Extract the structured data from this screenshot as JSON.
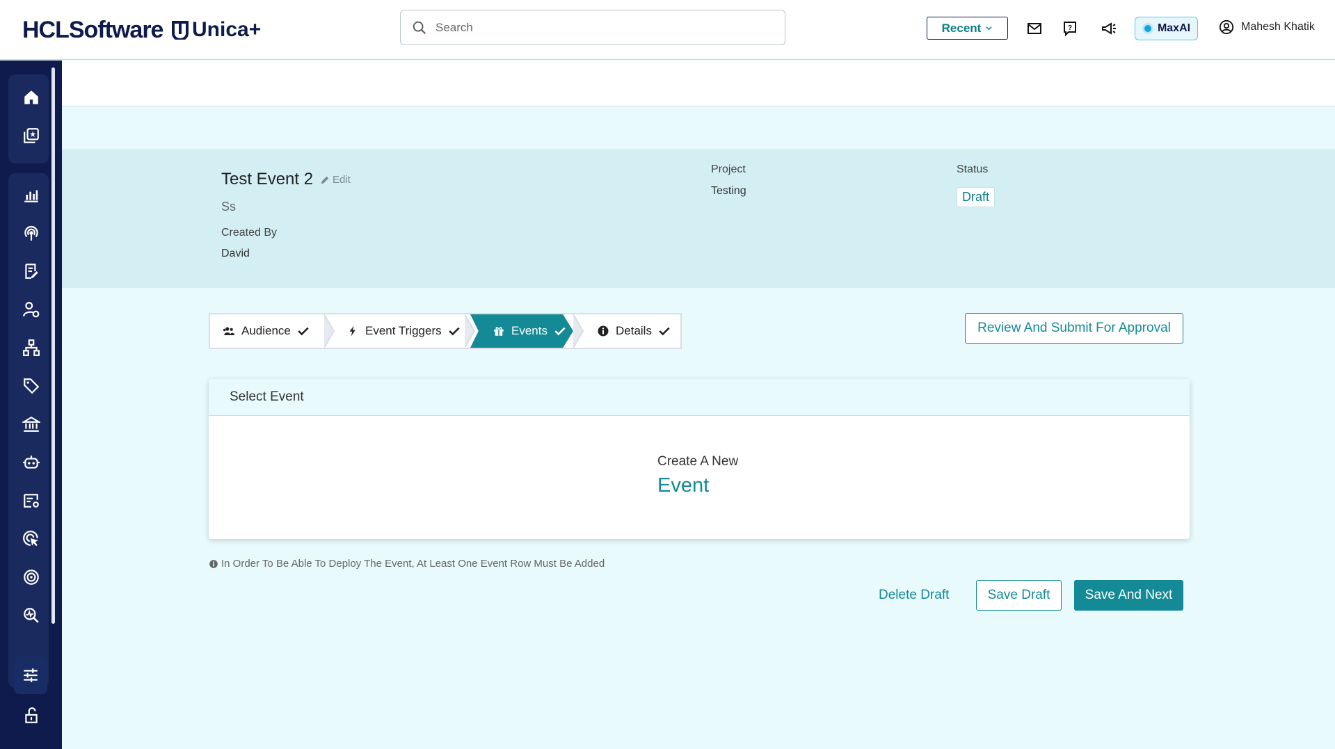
{
  "header": {
    "brand": "HCLSoftware",
    "product": "Unica+",
    "search_placeholder": "Search",
    "recent_label": "Recent",
    "maxai_label": "MaxAI",
    "user_name": "Mahesh Khatik",
    "icons": [
      "mail-icon",
      "help-icon",
      "announcement-icon"
    ]
  },
  "sidebar": {
    "items": [
      "home-icon",
      "gallery-icon",
      "analytics-icon",
      "broadcast-icon",
      "document-edit-icon",
      "user-settings-icon",
      "hierarchy-icon",
      "tags-icon",
      "bank-icon",
      "robot-icon",
      "list-settings-icon",
      "target-click-icon",
      "target-icon",
      "search-chart-icon",
      "sliders-icon",
      "unlock-icon"
    ]
  },
  "event": {
    "title": "Test Event 2",
    "edit_label": "Edit",
    "subtitle": "Ss",
    "created_by_label": "Created By",
    "created_by": "David",
    "project_label": "Project",
    "project": "Testing",
    "status_label": "Status",
    "status": "Draft"
  },
  "stepper": {
    "steps": [
      {
        "label": "Audience",
        "icon": "users-icon",
        "done": true,
        "active": false
      },
      {
        "label": "Event Triggers",
        "icon": "bolt-icon",
        "done": true,
        "active": false
      },
      {
        "label": "Events",
        "icon": "gift-icon",
        "done": true,
        "active": true
      },
      {
        "label": "Details",
        "icon": "info-icon",
        "done": true,
        "active": false
      }
    ]
  },
  "review_button": "Review And Submit For Approval",
  "card": {
    "header": "Select Event",
    "create_small": "Create A New",
    "create_big": "Event"
  },
  "note": "In Order To Be Able To Deploy The Event, At Least One Event Row Must Be Added",
  "actions": {
    "delete": "Delete Draft",
    "save": "Save Draft",
    "save_next": "Save And Next"
  },
  "colors": {
    "accent": "#138a95",
    "sidebar": "#0f1b4c",
    "background": "#e8fafb",
    "band": "#d4eff3"
  }
}
